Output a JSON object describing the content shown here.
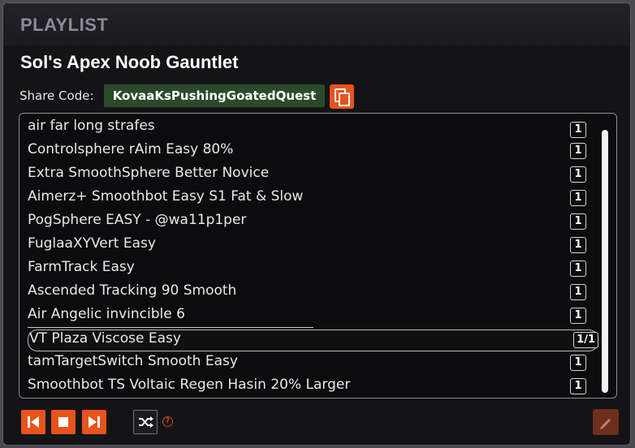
{
  "panel": {
    "title": "PLAYLIST",
    "playlist_name": "Sol's Apex Noob Gauntlet",
    "share_label": "Share Code:",
    "share_code": "KovaaKsPushingGoatedQuest"
  },
  "tracks": [
    {
      "name": "air far long strafes",
      "count": "1"
    },
    {
      "name": "Controlsphere rAim Easy 80%",
      "count": "1"
    },
    {
      "name": "Extra SmoothSphere Better Novice",
      "count": "1"
    },
    {
      "name": "Aimerz+ Smoothbot Easy S1 Fat & Slow",
      "count": "1"
    },
    {
      "name": "PogSphere EASY - @wa11p1per",
      "count": "1"
    },
    {
      "name": "FuglaaXYVert Easy",
      "count": "1"
    },
    {
      "name": "FarmTrack Easy",
      "count": "1"
    },
    {
      "name": "Ascended Tracking 90 Smooth",
      "count": "1"
    },
    {
      "name": "Air Angelic invincible 6",
      "count": "1"
    },
    {
      "name": "VT Plaza Viscose Easy",
      "count": "1/1",
      "active": true
    },
    {
      "name": "tamTargetSwitch Smooth Easy",
      "count": "1"
    },
    {
      "name": "Smoothbot TS Voltaic Regen Hasin 20% Larger",
      "count": "1"
    }
  ],
  "controls": {
    "help_glyph": "?"
  },
  "icons": [
    "copy-icon",
    "skip-back-icon",
    "stop-icon",
    "skip-forward-icon",
    "shuffle-icon",
    "help-icon",
    "pencil-icon"
  ],
  "colors": {
    "accent": "#e8531c",
    "share_code_bg": "#2b4a2b",
    "panel_bg": "#141417",
    "title_text": "#8a8a9a"
  }
}
